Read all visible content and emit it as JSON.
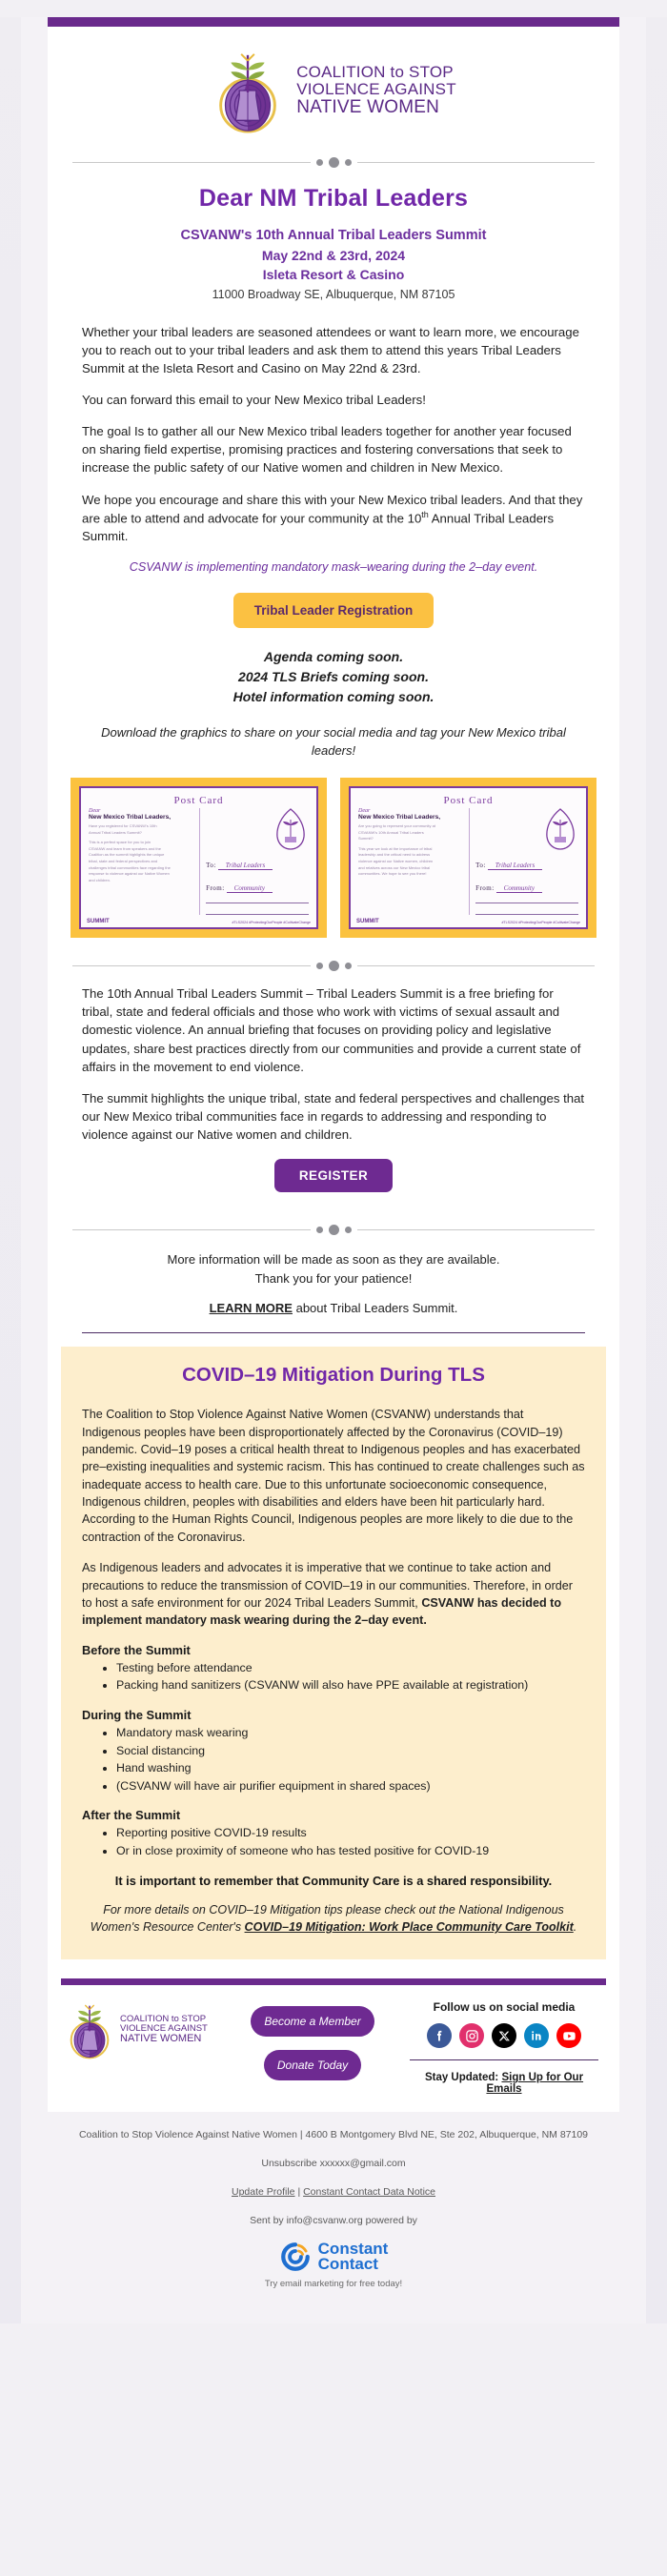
{
  "brand": {
    "logo_line1": "COALITION to STOP",
    "logo_line1_small": "to",
    "logo_line2": "VIOLENCE AGAINST",
    "logo_line3": "NATIVE WOMEN",
    "purple": "#6a2a8c",
    "gold": "#fbc142",
    "cream": "#fdeecd"
  },
  "header": {
    "title": "Dear NM Tribal Leaders",
    "event_line1": "CSVANW's 10th Annual Tribal Leaders Summit",
    "event_line2": "May 22nd & 23rd, 2024",
    "event_line3": "Isleta Resort & Casino",
    "address": "11000 Broadway SE, Albuquerque, NM 87105"
  },
  "intro": {
    "p1": "Whether your tribal leaders are seasoned attendees or want to learn more, we encourage you to reach out to your tribal leaders and ask them to attend this years Tribal Leaders Summit at the Isleta Resort and Casino on May 22nd & 23rd.",
    "p2": "You can forward this email to your New Mexico tribal Leaders!",
    "p3": "The goal Is to gather all our New Mexico tribal leaders together for another year focused on sharing field expertise, promising practices and fostering conversations that seek to increase the public safety of our Native women and children in New Mexico.",
    "p4_a": "We hope you encourage and share this with your New Mexico tribal leaders. And that they are able to attend and advocate for your community at the 10",
    "p4_sup": "th",
    "p4_b": " Annual Tribal Leaders Summit.",
    "mask_note": "CSVANW is implementing mandatory mask–wearing during the 2–day event."
  },
  "cta": {
    "registration_label": "Tribal Leader Registration",
    "register_label": "REGISTER"
  },
  "coming_soon": {
    "line1": "Agenda coming soon.",
    "line2": "2024 TLS Briefs coming soon.",
    "line3": "Hotel information coming soon."
  },
  "download_note": "Download the graphics to share on your social media and tag your New Mexico tribal leaders!",
  "postcards": [
    {
      "title": "Post Card",
      "dear": "Dear",
      "to_line": "New Mexico Tribal Leaders,",
      "body": [
        "Have you registered for CSVANW's 10th",
        "Annual Tribal Leaders Summit?",
        "This is a perfect space for you to join",
        "CSVANW and learn from speakers and the",
        "Coalition as the summit highlights the unique",
        "tribal, state and federal perspectives and",
        "challenges tribal communities face regarding the",
        "response to violence against our Native Women",
        "and children."
      ],
      "to_label": "To:",
      "to_value": "Tribal Leaders",
      "from_label": "From:",
      "from_value": "Community",
      "badge": "SUMMIT",
      "hashtags": "#TLS2024 #ProtectingOurPeople #CultivateChange"
    },
    {
      "title": "Post Card",
      "dear": "Dear",
      "to_line": "New Mexico Tribal Leaders,",
      "body": [
        "Are you going to represent your community at",
        "CSVANW's 10th Annual Tribal Leaders",
        "Summit?",
        "This year we look at the importance of tribal",
        "leadership and the critical need to address",
        "violence against our Native women, children",
        "and relatives across our New Mexico tribal",
        "communities. We hope to see you there!",
        ""
      ],
      "to_label": "To:",
      "to_value": "Tribal Leaders",
      "from_label": "From:",
      "from_value": "Community",
      "badge": "SUMMIT",
      "hashtags": "#TLS2024 #ProtectingOurPeople #CultivateChange"
    }
  ],
  "about": {
    "p1": "The 10th Annual Tribal Leaders Summit – Tribal Leaders Summit is a free briefing for tribal, state and federal officials and those who work with victims of sexual assault and domestic violence. An annual briefing that focuses on providing policy and legislative updates, share best practices directly from our communities and provide a current state of affairs in the movement to end violence.",
    "p2": "The summit highlights the unique tribal, state and federal perspectives and challenges that our New Mexico tribal communities face in regards to addressing and responding to violence against our Native women and children."
  },
  "more_info": {
    "line1": "More information will be made as soon as they are available.",
    "line2": "Thank you for your patience!",
    "learn_more_link": "LEARN MORE",
    "learn_more_rest": " about Tribal Leaders Summit."
  },
  "covid": {
    "title": "COVID–19 Mitigation During TLS",
    "p1": "The Coalition to Stop Violence Against Native Women (CSVANW) understands that Indigenous peoples have been disproportionately affected by the Coronavirus (COVID–19) pandemic. Covid–19 poses a critical health threat to Indigenous peoples and has exacerbated pre–existing inequalities and systemic racism. This has continued to create challenges such as inadequate access to health care. Due to this unfortunate socioeconomic consequence, Indigenous children, peoples with disabilities and elders have been hit particularly hard. According to the Human Rights Council, Indigenous peoples are more likely to die due to the contraction of the Coronavirus.",
    "p2_a": "As Indigenous leaders and advocates it is imperative that we continue to take action and precautions to reduce the transmission of COVID–19 in our communities. Therefore, in order to host a safe environment for our 2024 Tribal Leaders Summit, ",
    "p2_bold": "CSVANW has decided to implement mandatory mask wearing during the 2–day event.",
    "before_heading": "Before the Summit",
    "before_items": [
      "Testing before attendance",
      "Packing hand sanitizers (CSVANW will also have PPE available at registration)"
    ],
    "during_heading": "During the Summit",
    "during_items": [
      "Mandatory mask wearing",
      "Social distancing",
      "Hand washing",
      "(CSVANW will have air purifier equipment in shared spaces)"
    ],
    "after_heading": "After the Summit",
    "after_items": [
      "Reporting positive COVID-19 results",
      "Or in close proximity of someone who has tested positive for COVID-19"
    ],
    "shared_responsibility": "It is important to remember that Community Care is a shared responsibility.",
    "toolkit_a": "For more details on COVID–19 Mitigation tips please check out the National Indigenous Women's Resource Center's ",
    "toolkit_link": "COVID–19 Mitigation: Work Place Community Care Toolkit",
    "toolkit_b": "."
  },
  "footer": {
    "become_member": "Become a Member",
    "donate": "Donate Today",
    "follow_title": "Follow us on social media",
    "social": [
      {
        "name": "facebook-icon",
        "label": "Facebook"
      },
      {
        "name": "instagram-icon",
        "label": "Instagram"
      },
      {
        "name": "x-twitter-icon",
        "label": "X"
      },
      {
        "name": "linkedin-icon",
        "label": "LinkedIn"
      },
      {
        "name": "youtube-icon",
        "label": "YouTube"
      }
    ],
    "stay_updated_prefix": "Stay Updated: ",
    "stay_updated_link": "Sign Up for Our Emails"
  },
  "legal": {
    "org_address": "Coalition to Stop Violence Against Native Women | 4600 B Montgomery Blvd NE, Ste 202, Albuquerque, NM 87109",
    "unsubscribe": "Unsubscribe xxxxxx@gmail.com",
    "update_profile": "Update Profile",
    "separator": " | ",
    "data_notice": "Constant Contact Data Notice",
    "sent_by": "Sent by info@csvanw.org powered by",
    "cc_name_1": "Constant",
    "cc_name_2": "Contact",
    "cc_tagline": "Try email marketing for free today!"
  }
}
